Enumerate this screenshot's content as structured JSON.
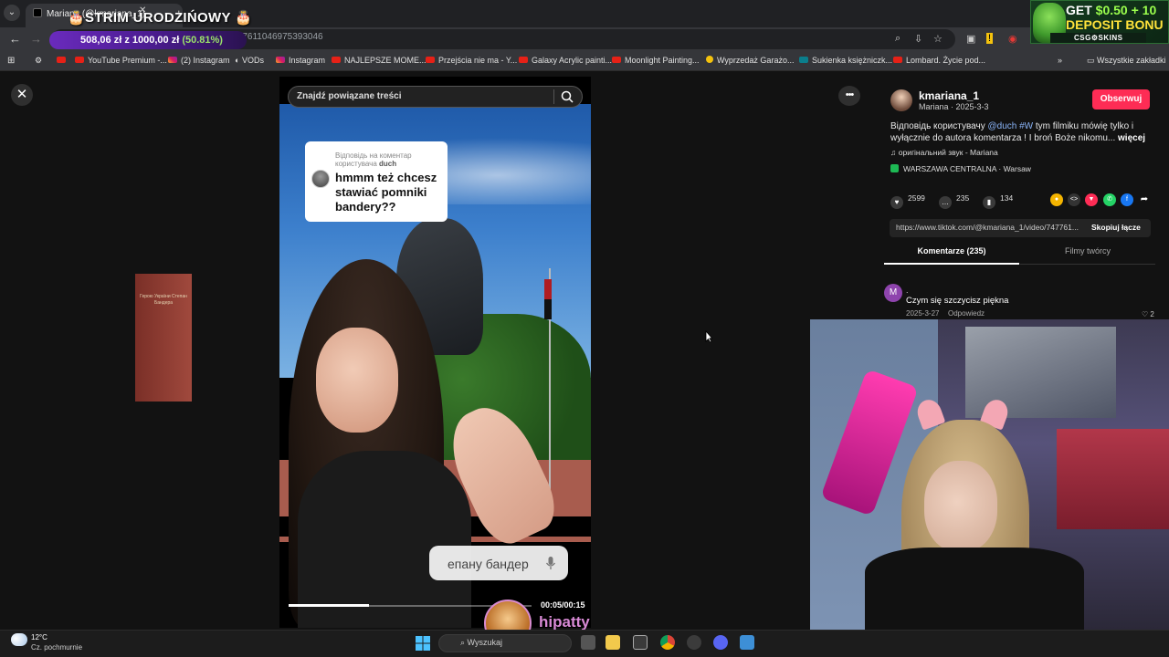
{
  "browser": {
    "tab_title": "Mariana (@kmariana_1)",
    "stream_title": "🎂STRIM URODZIŃOWY 🎂",
    "url": "video/7477611046975393046",
    "goal": {
      "current": "508,06 zł",
      "separator": "z",
      "target": "1000,00 zł",
      "percent": "(50.81%)"
    },
    "bookmarks": [
      {
        "label": "YouTube Premium -...",
        "icon": "youtube-icon"
      },
      {
        "label": "(2) Instagram",
        "icon": "instagram-icon"
      },
      {
        "label": "VODs",
        "icon": "globe-icon"
      },
      {
        "label": "Instagram",
        "icon": "instagram-icon"
      },
      {
        "label": "NAJLEPSZE MOME...",
        "icon": "youtube-icon"
      },
      {
        "label": "Przejścia nie ma - Y...",
        "icon": "youtube-icon"
      },
      {
        "label": "Galaxy Acrylic painti...",
        "icon": "youtube-icon"
      },
      {
        "label": "Moonlight Painting...",
        "icon": "youtube-icon"
      },
      {
        "label": "Wyprzedaż Garażo...",
        "icon": "yellow-dot-icon"
      },
      {
        "label": "Sukienka księżniczk...",
        "icon": "v-icon"
      },
      {
        "label": "Lombard. Życie pod...",
        "icon": "youtube-icon"
      }
    ],
    "all_bookmarks": "Wszystkie zakładki"
  },
  "banner": {
    "line1_a": "GET ",
    "line1_b": "$0.50 + 10",
    "line2": "DEPOSIT BONU",
    "brand": "CSG⚙SKINS"
  },
  "video": {
    "search_placeholder": "Znajdź powiązane treści",
    "reply_hint_prefix": "Відповідь на коментар користувача",
    "reply_hint_user": "duch",
    "reply_comment": "hmmm też chcesz stawiać pomniki bandery??",
    "pedestal_text": "Герою України Степан Бандера",
    "caption": "епану бандер",
    "time": "00:05/00:15",
    "progress": 0.33
  },
  "sidebar": {
    "username": "kmariana_1",
    "subline": "Mariana · 2025-3-3",
    "follow": "Obserwuj",
    "desc_prefix": "Відповідь користувачу ",
    "desc_mention": "@duch",
    "desc_hashtag": "#W",
    "desc_rest": " tym filmiku mówię tylko i wyłącznie do autora komentarza ! I broń Boże nikomu...",
    "desc_more": "więcej",
    "sound": "♫ оригінальний звук - Mariana",
    "location": "WARSZAWA CENTRALNA · Warsaw",
    "likes": "2599",
    "comments": "235",
    "saves": "134",
    "link": "https://www.tiktok.com/@kmariana_1/video/747761...",
    "copy_link": "Skopiuj łącze",
    "tab_comments": "Komentarze (235)",
    "tab_videos": "Filmy twórcy",
    "comment": {
      "avatar_letter": "M",
      "name": ".",
      "text": "Czym się szczycisz piękna",
      "date": "2025-3-27",
      "reply": "Odpowiedz",
      "likes": "♡ 2"
    }
  },
  "overlay": {
    "streamer_name": "hipatty"
  },
  "taskbar": {
    "temp": "12°C",
    "weather": "Cz. pochmurnie",
    "search": "Wyszukaj"
  }
}
